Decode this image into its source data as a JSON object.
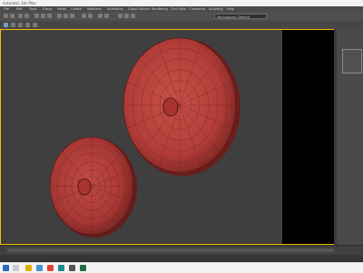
{
  "window": {
    "title": "Autodesk 3ds Max"
  },
  "menu": {
    "items": [
      "File",
      "Edit",
      "Tools",
      "Group",
      "Views",
      "Create",
      "Modifiers",
      "Animation",
      "Graph Editors",
      "Rendering",
      "Civil View",
      "Customize",
      "Scripting",
      "Help"
    ]
  },
  "toolbar": {
    "workspace": "Workspaces: Default"
  },
  "command_panel": {
    "header": ""
  },
  "colors": {
    "accent_border": "#f0c000",
    "object_red": "#b8403c",
    "viewport_bg": "#3f3f3f"
  },
  "icons": [
    "select-icon",
    "move-icon",
    "rotate-icon",
    "scale-icon",
    "link-icon",
    "undo-icon",
    "redo-icon",
    "render-icon",
    "windows-start-icon",
    "search-icon",
    "explorer-icon",
    "chrome-icon",
    "3dsmax-icon"
  ]
}
